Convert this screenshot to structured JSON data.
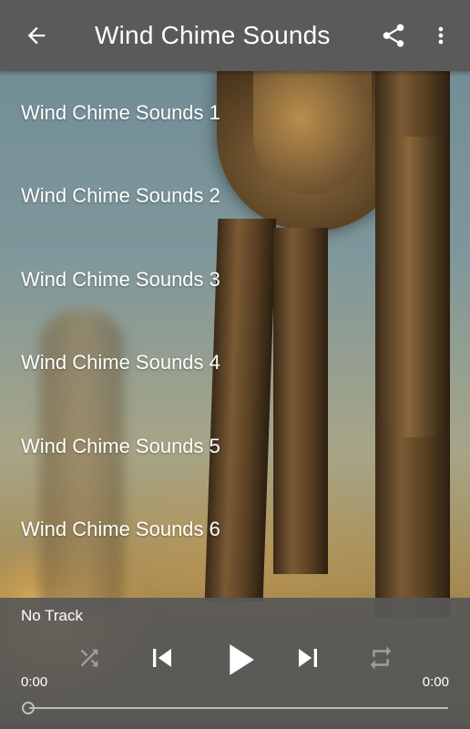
{
  "app_bar": {
    "title": "Wind Chime Sounds",
    "back_icon": "arrow-back-icon",
    "share_icon": "share-icon",
    "more_icon": "more-vert-icon"
  },
  "tracks": [
    {
      "label": "Wind Chime Sounds 1"
    },
    {
      "label": "Wind Chime Sounds 2"
    },
    {
      "label": "Wind Chime Sounds 3"
    },
    {
      "label": "Wind Chime Sounds 4"
    },
    {
      "label": "Wind Chime Sounds 5"
    },
    {
      "label": "Wind Chime Sounds 6"
    }
  ],
  "player": {
    "now_playing": "No Track",
    "current_time": "0:00",
    "duration": "0:00",
    "progress": 0,
    "controls": [
      "shuffle-icon",
      "skip-previous-icon",
      "play-icon",
      "skip-next-icon",
      "repeat-icon"
    ]
  },
  "colors": {
    "app_bar": "#5a5a5a",
    "player_bar": "#585858",
    "text": "#ffffff",
    "disabled_icon": "#9e9e9e"
  }
}
